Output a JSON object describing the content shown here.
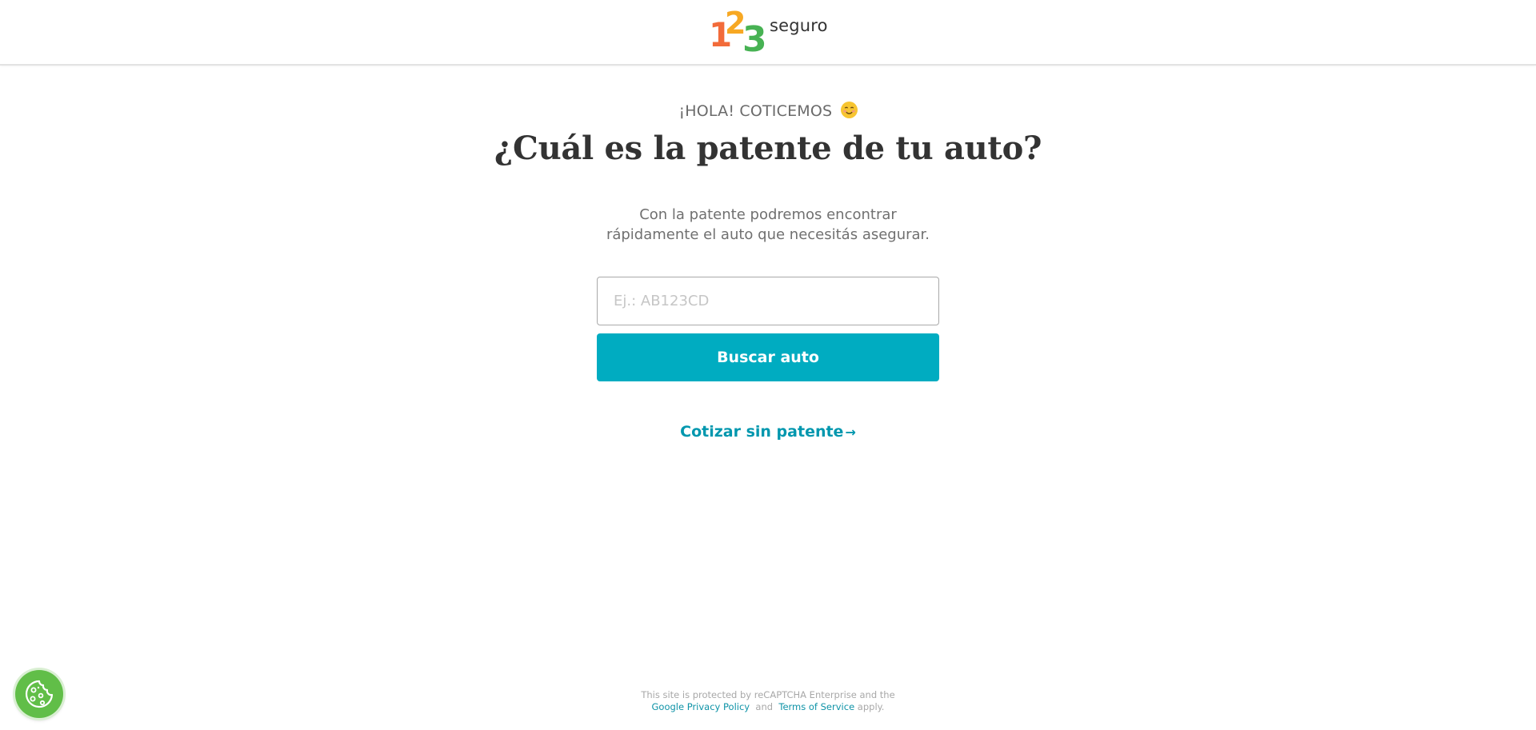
{
  "header": {
    "logo_text": "seguro",
    "logo_digits": [
      "1",
      "2",
      "3"
    ],
    "logo_colors": [
      "#f26b3a",
      "#f7a823",
      "#47b253"
    ]
  },
  "main": {
    "eyebrow": "¡HOLA! COTICEMOS",
    "eyebrow_icon": "smiling-face-emoji",
    "title": "¿Cuál es la patente de tu auto?",
    "subtitle_line1": "Con la patente podremos encontrar",
    "subtitle_line2": "rápidamente el auto que necesitás asegurar.",
    "plate_input": {
      "value": "",
      "placeholder": "Ej.: AB123CD"
    },
    "search_button_label": "Buscar auto",
    "quote_link_label": "Cotizar sin patente",
    "quote_link_icon": "arrow-right-icon"
  },
  "footer": {
    "line1": "This site is protected by reCAPTCHA Enterprise and the",
    "privacy_link": "Google Privacy Policy",
    "and": "and",
    "terms_link": "Terms of Service",
    "apply": "apply."
  },
  "cookie_button": {
    "icon": "cookie-icon",
    "color": "#61be48"
  },
  "colors": {
    "accent": "#00acc1",
    "link": "#0097ae",
    "text": "#333333"
  }
}
